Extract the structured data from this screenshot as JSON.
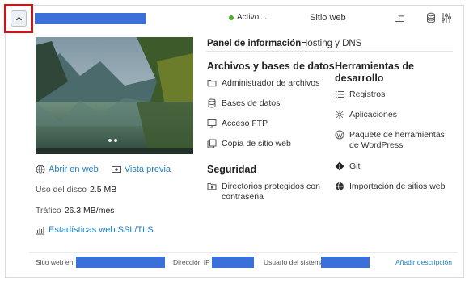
{
  "header": {
    "status": "Activo",
    "site_type": "Sitio web",
    "icons": [
      "chevron-up-icon",
      "folder-icon",
      "database-icon",
      "settings-sliders-icon"
    ],
    "redaction_color": "#3b6fd9",
    "highlight_color": "#c9161c"
  },
  "tabs": [
    {
      "label": "Panel de información",
      "active": true
    },
    {
      "label": "Hosting y DNS",
      "active": false
    }
  ],
  "left": {
    "open_web": "Abrir en web",
    "preview": "Vista previa",
    "disk_label": "Uso del disco",
    "disk_value": "2.5 MB",
    "traffic_label": "Tráfico",
    "traffic_value": "26.3 MB/mes",
    "ssl_stats": "Estadísticas web SSL/TLS"
  },
  "files_section": {
    "title": "Archivos y bases de datos",
    "items": [
      "Administrador de archivos",
      "Bases de datos",
      "Acceso FTP",
      "Copia de sitio web"
    ]
  },
  "security_section": {
    "title": "Seguridad",
    "items": [
      "Directorios protegidos con contraseña"
    ]
  },
  "dev_section": {
    "title": "Herramientas de desarrollo",
    "items": [
      "Registros",
      "Aplicaciones",
      "Paquete de herramientas de WordPress",
      "Git",
      "Importación de sitios web"
    ]
  },
  "footer": {
    "site_label": "Sitio web en",
    "ip_label": "Dirección IP",
    "user_label": "Usuario del sistema",
    "add_description": "Añadir descripción"
  },
  "accent_color": "#1f7fc2",
  "status_color": "#4caf28"
}
